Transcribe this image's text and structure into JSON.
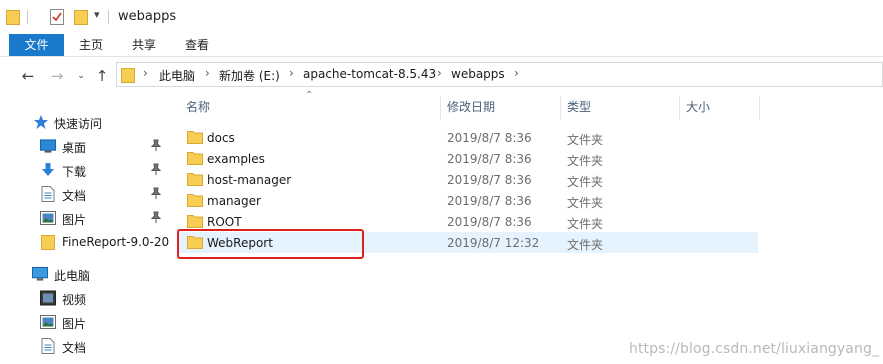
{
  "window": {
    "title": "webapps"
  },
  "ribbon": {
    "tabs": [
      {
        "label": "文件"
      },
      {
        "label": "主页"
      },
      {
        "label": "共享"
      },
      {
        "label": "查看"
      }
    ]
  },
  "address": {
    "crumbs": [
      {
        "label": "此电脑"
      },
      {
        "label": "新加卷 (E:)"
      },
      {
        "label": "apache-tomcat-8.5.43"
      },
      {
        "label": "webapps"
      }
    ]
  },
  "sidebar": {
    "items": [
      {
        "label": "快速访问",
        "icon": "star-icon"
      },
      {
        "label": "桌面",
        "icon": "desktop-icon",
        "pinned": true
      },
      {
        "label": "下载",
        "icon": "download-icon",
        "pinned": true
      },
      {
        "label": "文档",
        "icon": "document-icon",
        "pinned": true
      },
      {
        "label": "图片",
        "icon": "picture-icon",
        "pinned": true
      },
      {
        "label": "FineReport-9.0-20",
        "icon": "folder-icon"
      },
      {
        "label": "此电脑",
        "icon": "computer-icon"
      },
      {
        "label": "视频",
        "icon": "video-icon"
      },
      {
        "label": "图片",
        "icon": "picture-icon"
      },
      {
        "label": "文档",
        "icon": "document-icon"
      }
    ]
  },
  "columns": {
    "name": "名称",
    "modified": "修改日期",
    "type": "类型",
    "size": "大小"
  },
  "files": [
    {
      "name": "docs",
      "modified": "2019/8/7 8:36",
      "type": "文件夹"
    },
    {
      "name": "examples",
      "modified": "2019/8/7 8:36",
      "type": "文件夹"
    },
    {
      "name": "host-manager",
      "modified": "2019/8/7 8:36",
      "type": "文件夹"
    },
    {
      "name": "manager",
      "modified": "2019/8/7 8:36",
      "type": "文件夹"
    },
    {
      "name": "ROOT",
      "modified": "2019/8/7 8:36",
      "type": "文件夹"
    },
    {
      "name": "WebReport",
      "modified": "2019/8/7 12:32",
      "type": "文件夹",
      "selected": true
    }
  ],
  "watermark": "https://blog.csdn.net/liuxiangyang_",
  "colors": {
    "accent": "#1979ca",
    "folder": "#f7cd53",
    "selection": "#e5f3ff",
    "highlight_box": "#e0201f"
  }
}
